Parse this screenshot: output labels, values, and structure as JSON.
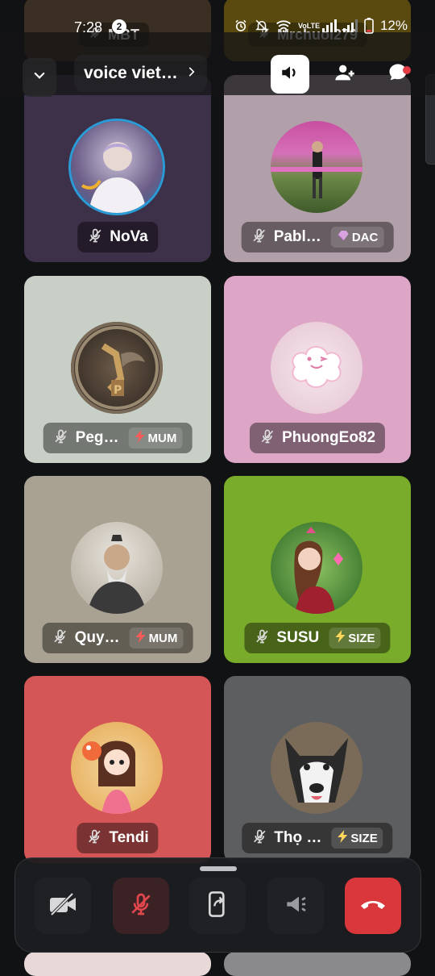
{
  "status_bar": {
    "time": "7:28",
    "notification_count": "2",
    "network": "VoLTE",
    "battery": "12%"
  },
  "header": {
    "title": "voice viet…"
  },
  "peek_top": {
    "left_label": "MBT",
    "right_label": "Mrchuoi279"
  },
  "tiles": [
    {
      "name": "NoVa",
      "tag": "",
      "tag_icon": "",
      "bg": "#3d3049",
      "avatar_bg": "#5b4f72"
    },
    {
      "name": "Pabl…",
      "tag": "DAC",
      "tag_icon": "gem-icon",
      "bg": "#b19fa9",
      "avatar_bg": "#6b7a4e"
    },
    {
      "name": "Peg…",
      "tag": "MUM",
      "tag_icon": "lightning-icon",
      "bg": "#c8cfc7",
      "avatar_bg": "#4a4038"
    },
    {
      "name": "PhuongEo82",
      "tag": "",
      "tag_icon": "",
      "bg": "#dda6c6",
      "avatar_bg": "#e9cfd9"
    },
    {
      "name": "Quy…",
      "tag": "MUM",
      "tag_icon": "lightning-icon",
      "bg": "#a9a292",
      "avatar_bg": "#8f8a80"
    },
    {
      "name": "SUSU",
      "tag": "SIZE",
      "tag_icon": "lightning-icon",
      "bg": "#7aac2c",
      "avatar_bg": "#4e8a3a"
    },
    {
      "name": "Tendi",
      "tag": "",
      "tag_icon": "",
      "bg": "#d45656",
      "avatar_bg": "#e0a070"
    },
    {
      "name": "Thọ …",
      "tag": "SIZE",
      "tag_icon": "lightning-icon",
      "bg": "#5d5e60",
      "avatar_bg": "#b8a890"
    }
  ],
  "colors": {
    "end_call": "#da373c",
    "muted_red": "#e2474d",
    "lightning": "#ff5a5a"
  }
}
